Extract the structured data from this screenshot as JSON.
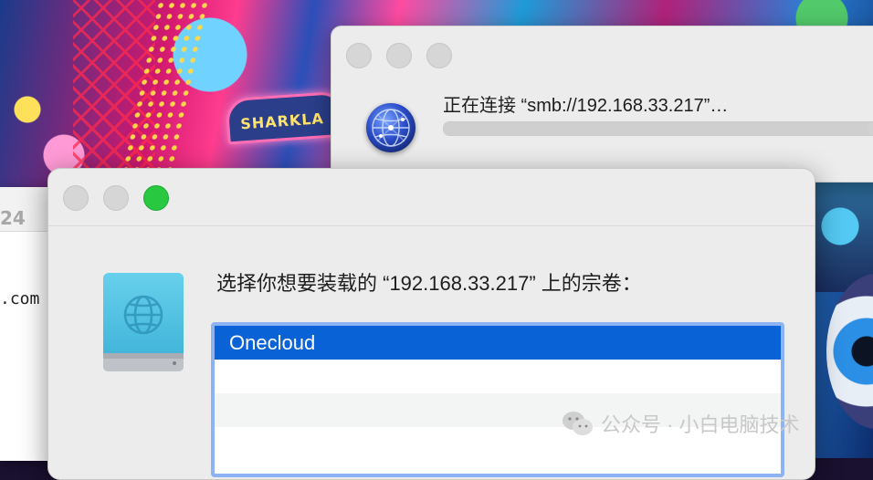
{
  "wallpaper": {
    "sign_text": "SHARKLA"
  },
  "background_window": {
    "partial_title": "24",
    "partial_text": ".com"
  },
  "connect_window": {
    "status_text": "正在连接 “smb://192.168.33.217”…",
    "progress_icon": "network-globe-icon",
    "window_controls": [
      "close-button",
      "minimize-button",
      "zoom-button"
    ]
  },
  "volume_window": {
    "prompt": "选择你想要装载的 “192.168.33.217” 上的宗卷：",
    "drive_icon": "network-drive-icon",
    "volumes": [
      {
        "label": "Onecloud",
        "selected": true
      },
      {
        "label": "",
        "selected": false
      },
      {
        "label": "",
        "selected": false
      },
      {
        "label": "",
        "selected": false
      }
    ],
    "window_controls": [
      "close-button",
      "minimize-button",
      "zoom-button"
    ],
    "colors": {
      "selection": "#0a63d6",
      "focus_ring": "#8cb3f4",
      "zoom_button": "#28c840"
    }
  },
  "watermark": {
    "text": "公众号 · 小白电脑技术",
    "icon": "wechat-icon"
  }
}
